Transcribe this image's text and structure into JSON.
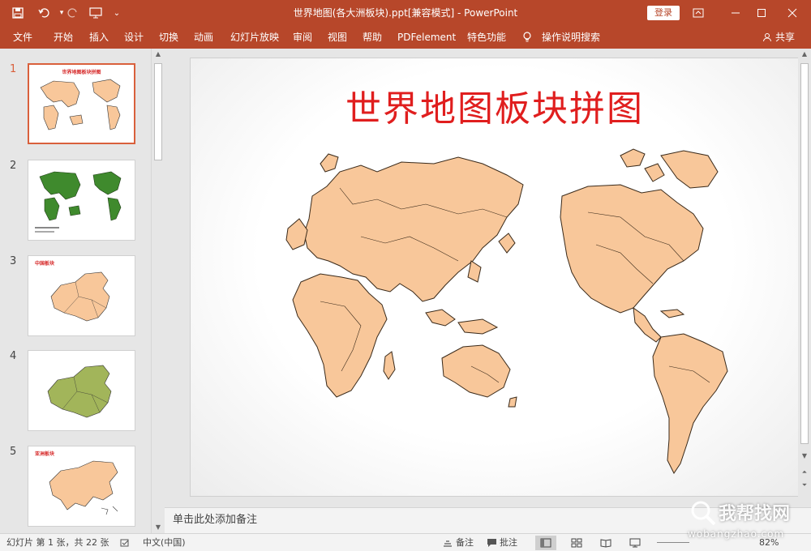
{
  "titlebar": {
    "doc_title": "世界地图(各大洲板块).ppt[兼容模式] - PowerPoint",
    "login_label": "登录"
  },
  "ribbon": {
    "tabs": [
      "文件",
      "开始",
      "插入",
      "设计",
      "切换",
      "动画",
      "幻灯片放映",
      "审阅",
      "视图",
      "帮助",
      "PDFelement",
      "特色功能"
    ],
    "search_label": "操作说明搜索",
    "share_label": "共享"
  },
  "thumbnails": [
    {
      "num": "1",
      "title": "世界地图板块拼图"
    },
    {
      "num": "2",
      "title": ""
    },
    {
      "num": "3",
      "title": "中国板块"
    },
    {
      "num": "4",
      "title": ""
    },
    {
      "num": "5",
      "title": "亚洲板块"
    }
  ],
  "slide": {
    "title": "世界地图板块拼图"
  },
  "notes": {
    "placeholder": "单击此处添加备注"
  },
  "statusbar": {
    "slide_info": "幻灯片 第 1 张，共 22 张",
    "language": "中文(中国)",
    "notes_label": "备注",
    "comments_label": "批注",
    "zoom": "82%"
  },
  "watermark": {
    "line1": "我帮找网",
    "line2": "wobangzhao.com"
  },
  "colors": {
    "accent": "#b7472a",
    "map_fill": "#f8c79a",
    "title_red": "#e01e1e",
    "green_map": "#3f8a2d",
    "olive_map": "#a2b55a"
  }
}
